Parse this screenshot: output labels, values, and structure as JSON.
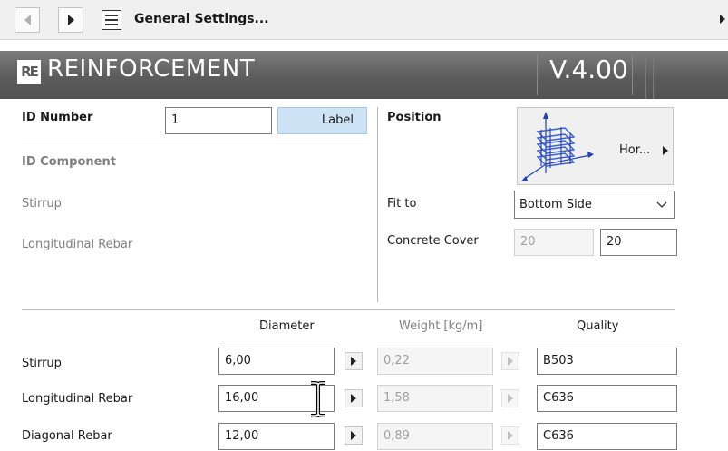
{
  "nav": {
    "title": "General Settings..."
  },
  "header": {
    "logo_text": "RE",
    "title": "REINFORCEMENT",
    "version": "V.4.00"
  },
  "id": {
    "number_label": "ID Number",
    "number_value": "1",
    "label_button": "Label",
    "component_label": "ID Component",
    "stirrup": "Stirrup",
    "longitudinal": "Longitudinal Rebar"
  },
  "position": {
    "label": "Position",
    "orientation": "Hor...",
    "fit_to_label": "Fit to",
    "fit_to_value": "Bottom Side",
    "cover_label": "Concrete Cover",
    "cover_default": "20",
    "cover_value": "20"
  },
  "table": {
    "headers": {
      "diameter": "Diameter",
      "weight": "Weight [kg/m]",
      "quality": "Quality"
    },
    "rows": [
      {
        "name": "Stirrup",
        "diameter": "6,00",
        "weight": "0,22",
        "quality": "B503"
      },
      {
        "name": "Longitudinal Rebar",
        "diameter": "16,00",
        "weight": "1,58",
        "quality": "C636"
      },
      {
        "name": "Diagonal Rebar",
        "diameter": "12,00",
        "weight": "0,89",
        "quality": "C636"
      }
    ]
  },
  "colors": {
    "header_bg": "#5c5c5c",
    "label_button_bg": "#cfe3f7",
    "accent_blue": "#1f3fbf"
  }
}
